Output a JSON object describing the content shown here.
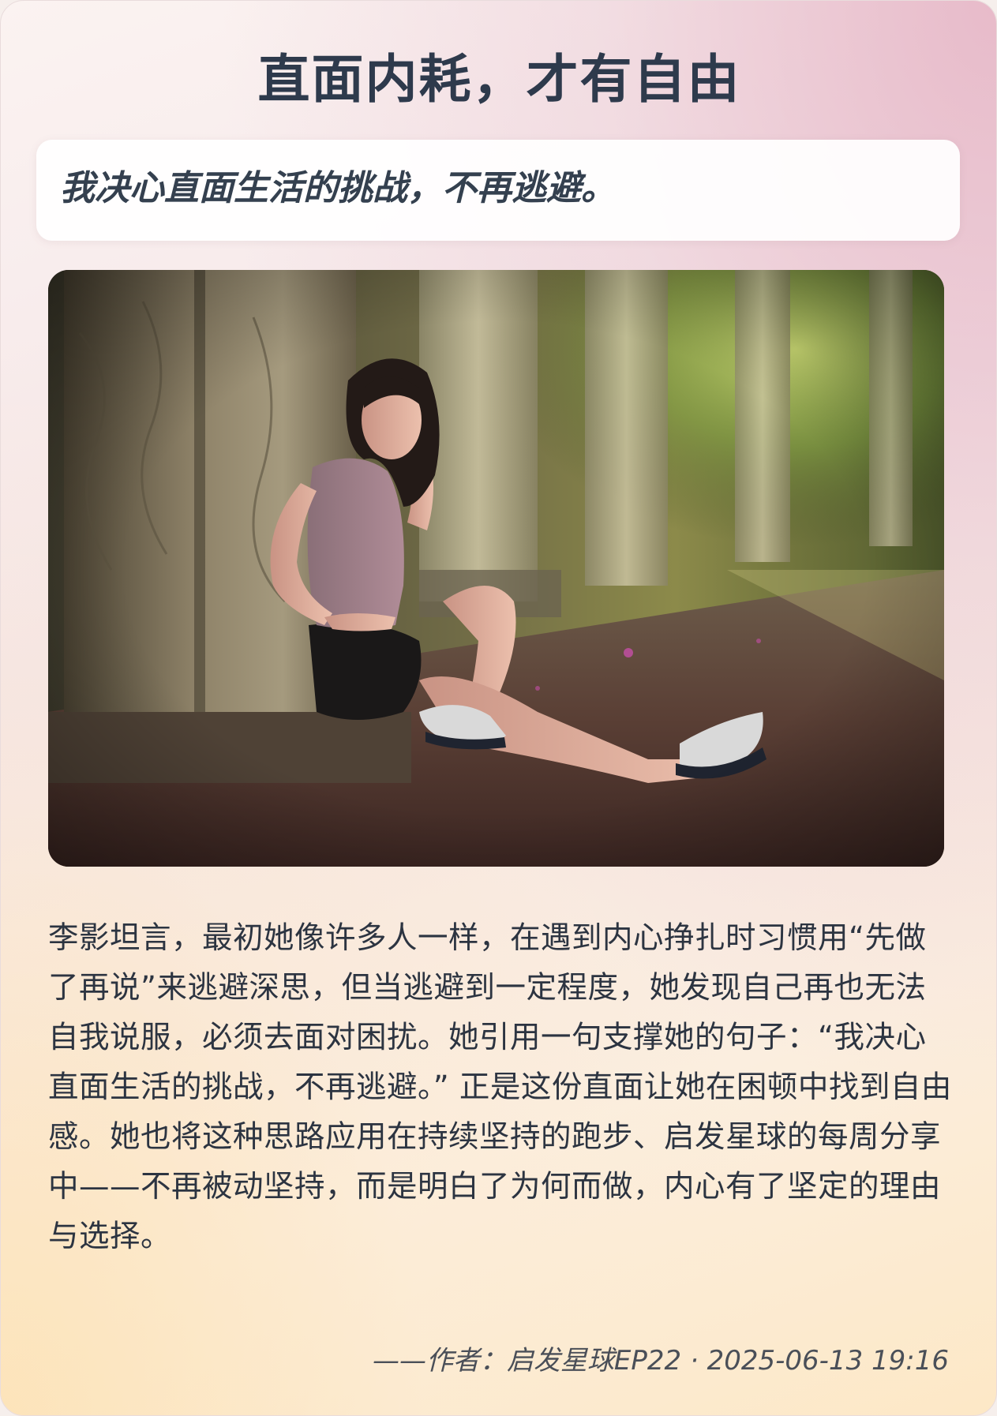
{
  "title": "直面内耗，才有自由",
  "quote": "我决心直面生活的挑战，不再逃避。",
  "photo": {
    "icon": "photo-woman-sitting-by-pillar"
  },
  "body": "李影坦言，最初她像许多人一样，在遇到内心挣扎时习惯用“先做了再说”来逃避深思，但当逃避到一定程度，她发现自己再也无法自我说服，必须去面对困扰。她引用一句支撑她的句子：“我决心直面生活的挑战，不再逃避。” 正是这份直面让她在困顿中找到自由感。她也将这种思路应用在持续坚持的跑步、启发星球的每周分享中——不再被动坚持，而是明白了为何而做，内心有了坚定的理由与选择。",
  "footer": {
    "author_line": "——作者：启发星球EP22 · 2025-06-13 19:16"
  }
}
